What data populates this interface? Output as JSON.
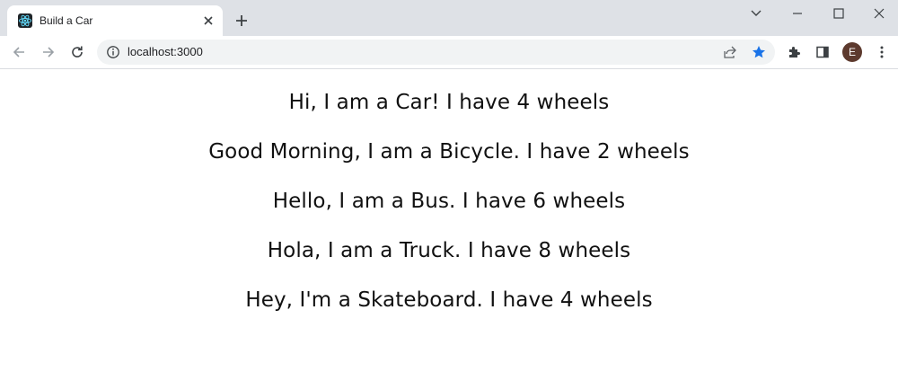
{
  "browser": {
    "tab": {
      "title": "Build a Car",
      "favicon": "react-icon"
    },
    "address_bar": {
      "url": "localhost:3000"
    },
    "profile_initial": "E",
    "accent_color": "#1a73e8"
  },
  "page": {
    "lines": [
      "Hi, I am a Car! I have 4 wheels",
      "Good Morning, I am a Bicycle. I have 2 wheels",
      "Hello, I am a Bus. I have 6 wheels",
      "Hola, I am a Truck. I have 8 wheels",
      "Hey, I'm a Skateboard. I have 4 wheels"
    ]
  }
}
